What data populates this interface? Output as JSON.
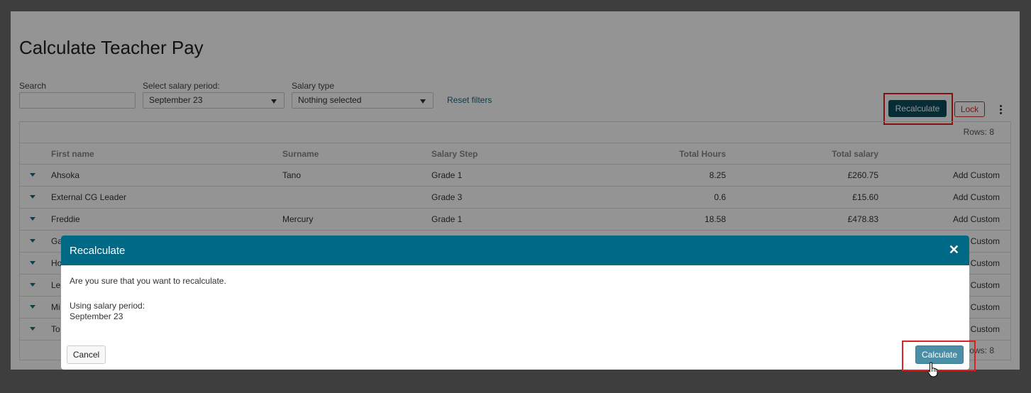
{
  "page": {
    "title": "Calculate Teacher Pay"
  },
  "filters": {
    "search_label": "Search",
    "search_value": "",
    "salary_period_label": "Select salary period:",
    "salary_period_value": "September 23",
    "salary_type_label": "Salary type",
    "salary_type_value": "Nothing selected",
    "reset_label": "Reset filters"
  },
  "toolbar": {
    "recalculate_label": "Recalculate",
    "lock_label": "Lock",
    "more_icon": "vertical-ellipsis-icon"
  },
  "table": {
    "rows_count_text": "Rows: 8",
    "rows_count_bottom_text": "ows: 8",
    "headers": {
      "first_name": "First name",
      "surname": "Surname",
      "salary_step": "Salary Step",
      "total_hours": "Total Hours",
      "total_salary": "Total salary"
    },
    "rows": [
      {
        "first_name": "Ahsoka",
        "surname": "Tano",
        "salary_step": "Grade 1",
        "total_hours": "8.25",
        "total_salary": "£260.75",
        "action": "Add Custom"
      },
      {
        "first_name": "External CG Leader",
        "surname": "",
        "salary_step": "Grade 3",
        "total_hours": "0.6",
        "total_salary": "£15.60",
        "action": "Add Custom"
      },
      {
        "first_name": "Freddie",
        "surname": "Mercury",
        "salary_step": "Grade 1",
        "total_hours": "18.58",
        "total_salary": "£478.83",
        "action": "Add Custom"
      },
      {
        "first_name": "Ga",
        "surname": "",
        "salary_step": "",
        "total_hours": "",
        "total_salary": "",
        "action": "Custom"
      },
      {
        "first_name": "Ho",
        "surname": "",
        "salary_step": "",
        "total_hours": "",
        "total_salary": "",
        "action": "Custom"
      },
      {
        "first_name": "Le",
        "surname": "",
        "salary_step": "",
        "total_hours": "",
        "total_salary": "",
        "action": "Custom"
      },
      {
        "first_name": "Mi",
        "surname": "",
        "salary_step": "",
        "total_hours": "",
        "total_salary": "",
        "action": "Custom"
      },
      {
        "first_name": "To",
        "surname": "",
        "salary_step": "",
        "total_hours": "",
        "total_salary": "",
        "action": "Custom"
      }
    ]
  },
  "modal": {
    "title": "Recalculate",
    "close_glyph": "✕",
    "message": "Are you sure that you want to recalculate.",
    "period_label": "Using salary period:",
    "period_value": "September 23",
    "cancel_label": "Cancel",
    "calculate_label": "Calculate"
  },
  "colors": {
    "modal_header": "#006986",
    "primary_button": "#0b4c5f",
    "link": "#186b84",
    "highlight": "#e02020"
  }
}
